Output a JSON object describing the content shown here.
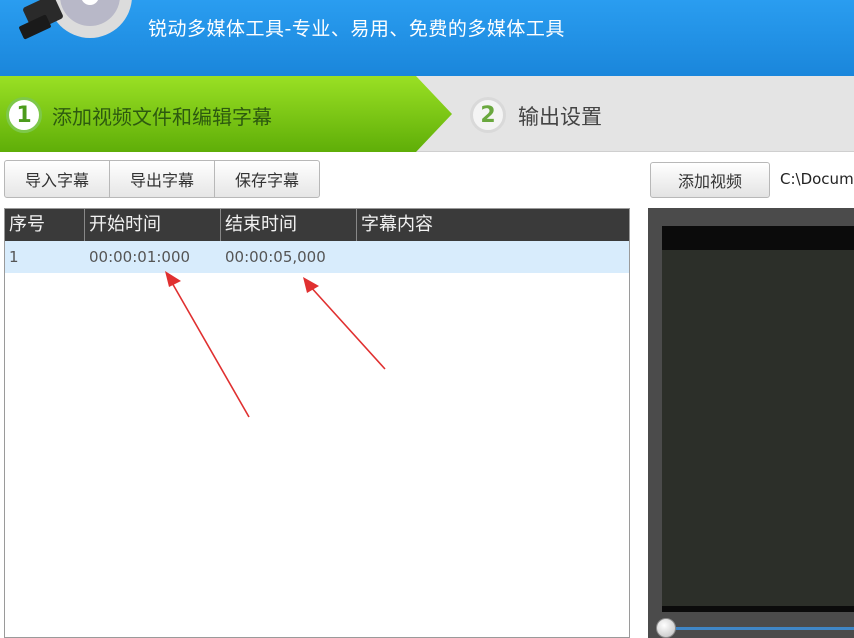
{
  "header": {
    "title": "锐动多媒体工具-专业、易用、免费的多媒体工具"
  },
  "steps": [
    {
      "number": "1",
      "label": "添加视频文件和编辑字幕"
    },
    {
      "number": "2",
      "label": "输出设置"
    }
  ],
  "toolbar": {
    "import_label": "导入字幕",
    "export_label": "导出字幕",
    "save_label": "保存字幕"
  },
  "table": {
    "columns": [
      "序号",
      "开始时间",
      "结束时间",
      "字幕内容"
    ],
    "rows": [
      {
        "index": "1",
        "start": "00:00:01:000",
        "end": "00:00:05,000",
        "text": ""
      }
    ]
  },
  "video": {
    "add_label": "添加视频",
    "path": "C:\\Docum"
  },
  "colors": {
    "header_blue": "#1a86db",
    "step_active_green": "#7ac70c",
    "row_highlight": "#d8ecfc",
    "annotation_arrow": "#e03030"
  }
}
